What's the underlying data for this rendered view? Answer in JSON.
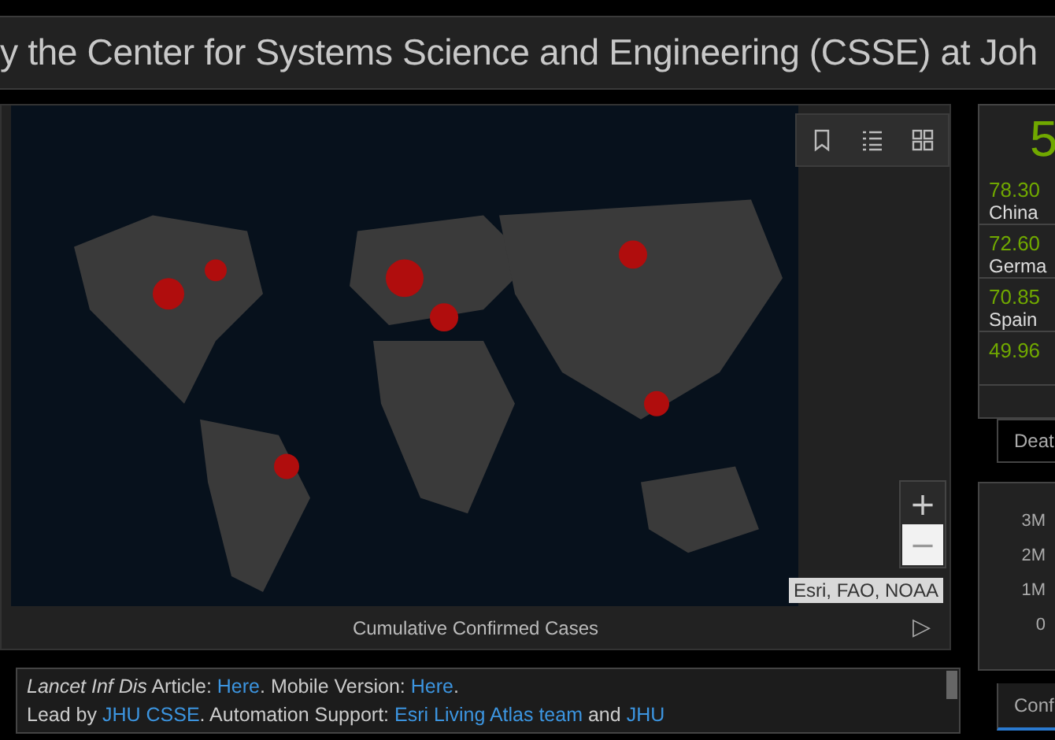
{
  "header": {
    "title": "y the Center for Systems Science and Engineering (CSSE) at Joh"
  },
  "map": {
    "kind": "picture",
    "zoom_buttons": [
      {
        "label": "+",
        "selected": false
      },
      {
        "label": "−",
        "selected": true
      }
    ],
    "attribution": "Esri, FAO, NOAA",
    "footer": "Cumulative Confirmed Cases",
    "next": "▷"
  },
  "credits": [
    [
      {
        "kind": "italic",
        "text": "Lancet Inf Dis"
      },
      {
        "kind": "plain",
        "text": " Article: "
      },
      {
        "kind": "link",
        "text": "Here"
      },
      {
        "kind": "plain",
        "text": ". Mobile Version: "
      },
      {
        "kind": "link",
        "text": "Here"
      },
      {
        "kind": "plain",
        "text": "."
      }
    ],
    [
      {
        "kind": "plain",
        "text": "Lead by "
      },
      {
        "kind": "link",
        "text": "JHU CSSE"
      },
      {
        "kind": "plain",
        "text": ". Automation Support: "
      },
      {
        "kind": "link",
        "text": "Esri Living Atlas team"
      },
      {
        "kind": "plain",
        "text": " and "
      },
      {
        "kind": "link",
        "text": "JHU"
      }
    ]
  ],
  "stats_panel": {
    "total": "5",
    "rows": [
      {
        "value": "78.30",
        "name": "China"
      },
      {
        "value": "72.60",
        "name": "Germa"
      },
      {
        "value": "70.85",
        "name": "Spain"
      },
      {
        "value": "49.96"
      }
    ],
    "tab": "Deat"
  },
  "chart_panel": {
    "y_ticks": [
      "3M",
      "2M",
      "1M",
      "0"
    ],
    "tab": {
      "label": "Conf",
      "selected": true
    }
  }
}
